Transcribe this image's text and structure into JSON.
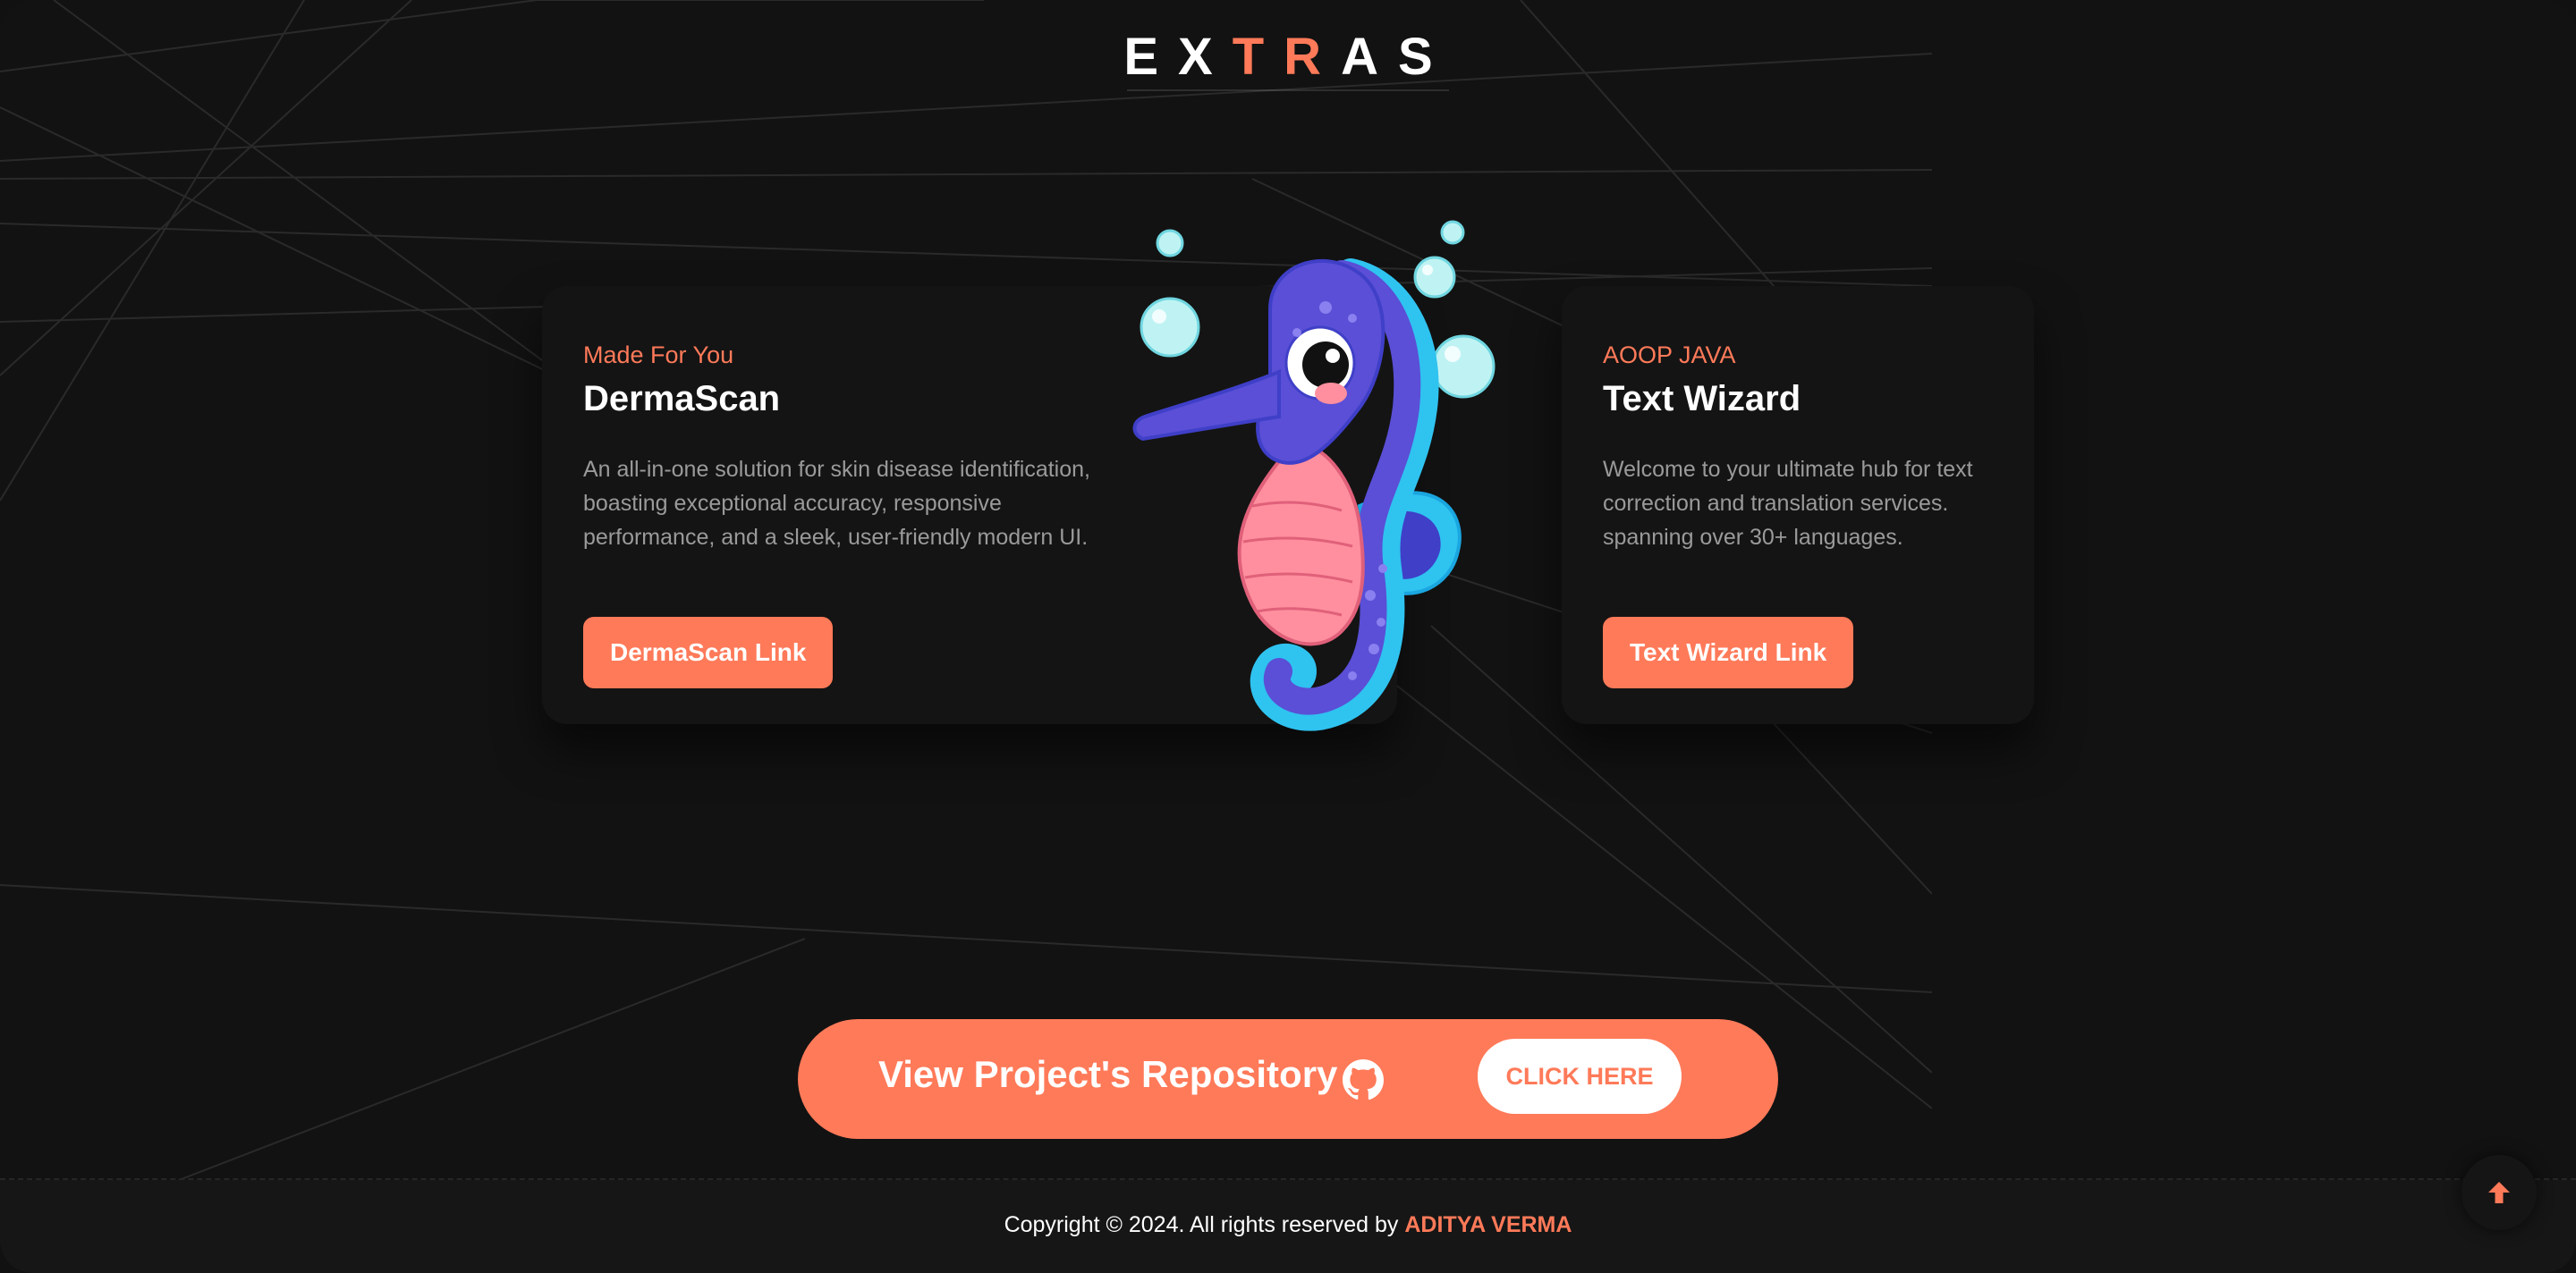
{
  "section": {
    "title_letters": [
      "E",
      "X",
      "T",
      "R",
      "A",
      "S"
    ],
    "accent_letter_indices": [
      2,
      3
    ]
  },
  "cards": [
    {
      "kicker": "Made For You",
      "title": "DermaScan",
      "description": "An all-in-one solution for skin disease identification, boasting exceptional accuracy, responsive performance, and a sleek, user-friendly modern UI.",
      "button": "DermaScan Link"
    },
    {
      "kicker": "AOOP JAVA",
      "title": "Text Wizard",
      "description": "Welcome to your ultimate hub for text correction and translation services. spanning over 30+ languages.",
      "button": "Text Wizard Link"
    }
  ],
  "repo": {
    "label": "View Project's Repository",
    "icon": "github-icon",
    "button": "CLICK HERE"
  },
  "footer": {
    "copyright": "Copyright © 2024. All rights reserved by",
    "author": "ADITYA VERMA"
  },
  "icons": {
    "scroll_top": "arrow-up-icon",
    "illustration": "seahorse-illustration"
  },
  "colors": {
    "accent": "#ff7a59",
    "background": "#121212",
    "card": "#141414",
    "muted_text": "#9a9a9a"
  }
}
